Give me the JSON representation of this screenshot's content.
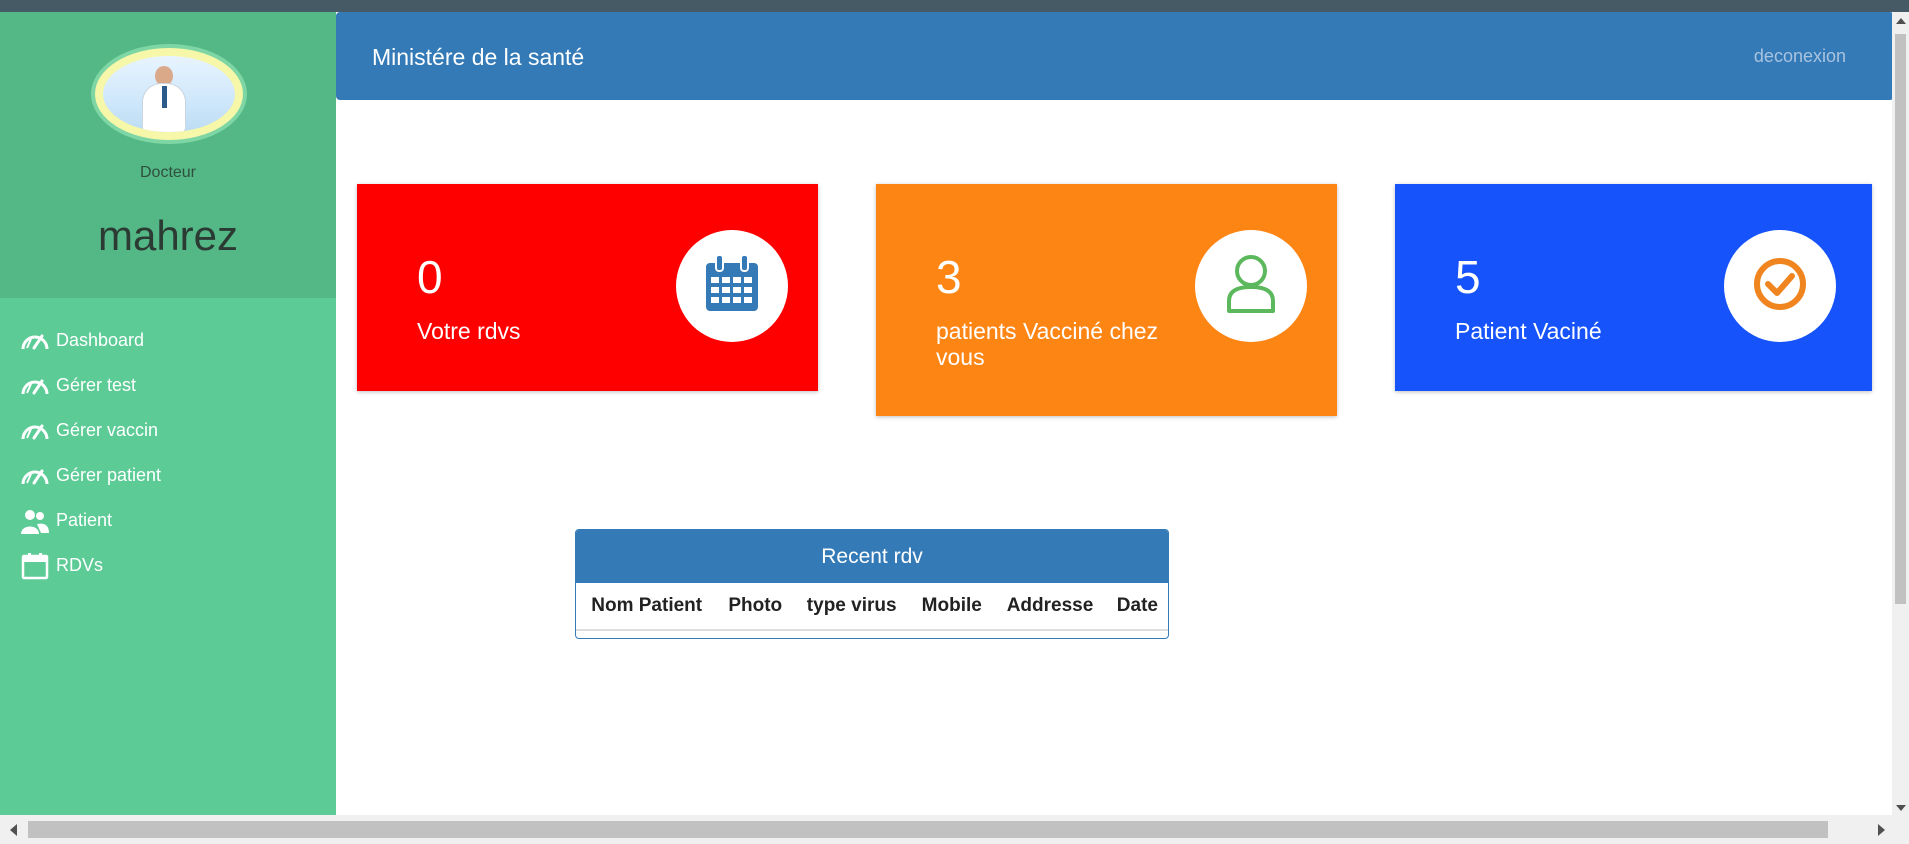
{
  "header": {
    "title": "Ministére de la santé",
    "logout_label": "deconexion"
  },
  "profile": {
    "role": "Docteur",
    "username": "mahrez"
  },
  "sidebar": {
    "items": [
      {
        "label": "Dashboard",
        "icon": "speedometer-icon"
      },
      {
        "label": "Gérer test",
        "icon": "speedometer-icon"
      },
      {
        "label": "Gérer vaccin",
        "icon": "speedometer-icon"
      },
      {
        "label": "Gérer patient",
        "icon": "speedometer-icon"
      },
      {
        "label": "Patient",
        "icon": "users-icon"
      },
      {
        "label": "RDVs",
        "icon": "calendar-icon"
      }
    ]
  },
  "cards": [
    {
      "count": "0",
      "label": "Votre rdvs",
      "color": "#ff0000",
      "icon": "calendar-icon",
      "icon_color": "#337ab7"
    },
    {
      "count": "3",
      "label": "patients Vacciné chez vous",
      "color": "#fd8514",
      "icon": "user-icon",
      "icon_color": "#5cb85c"
    },
    {
      "count": "5",
      "label": "Patient Vaciné",
      "color": "#1653fb",
      "icon": "check-circle-icon",
      "icon_color": "#f0841e"
    }
  ],
  "recent": {
    "title": "Recent rdv",
    "columns": [
      "Nom Patient",
      "Photo",
      "type virus",
      "Mobile",
      "Addresse",
      "Date"
    ]
  },
  "colors": {
    "sidebar": "#5ccb96",
    "sidebar_top": "#53b885",
    "header": "#337ab7"
  }
}
